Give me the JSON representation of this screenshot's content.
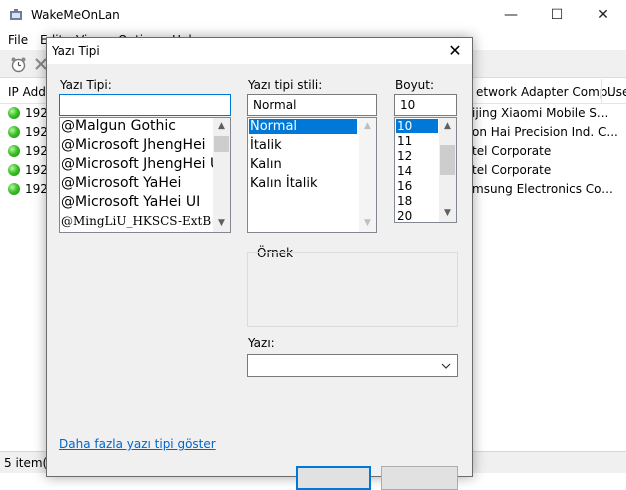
{
  "window": {
    "title": "WakeMeOnLan",
    "menu": [
      "File",
      "Edit",
      "View",
      "Options",
      "Help"
    ]
  },
  "list": {
    "columns": [
      "IP Addr",
      "etwork Adapter Comp...",
      "Use"
    ],
    "rows": [
      {
        "ip": "192.",
        "adapter": "ijing Xiaomi Mobile S..."
      },
      {
        "ip": "192.",
        "adapter": "on Hai Precision Ind. C..."
      },
      {
        "ip": "192.",
        "adapter": "tel Corporate"
      },
      {
        "ip": "192.",
        "adapter": "tel Corporate"
      },
      {
        "ip": "192.",
        "adapter": "msung Electronics Co..."
      }
    ]
  },
  "status": {
    "text": "5 item(s)"
  },
  "dialog": {
    "title": "Yazı Tipi",
    "font": {
      "label": "Yazı Tipi:",
      "value": "",
      "items": [
        "@Malgun Gothic",
        "@Microsoft JhengHei",
        "@Microsoft JhengHei U",
        "@Microsoft YaHei",
        "@Microsoft YaHei UI",
        "@MingLiU_HKSCS-ExtB"
      ]
    },
    "style": {
      "label": "Yazı tipi stili:",
      "value": "Normal",
      "items": [
        "Normal",
        "İtalik",
        "Kalın",
        "Kalın İtalik"
      ]
    },
    "size": {
      "label": "Boyut:",
      "value": "10",
      "items": [
        "10",
        "11",
        "12",
        "14",
        "16",
        "18",
        "20"
      ]
    },
    "sample": {
      "label": "Örnek"
    },
    "script": {
      "label": "Yazı:",
      "value": ""
    },
    "more_fonts_link": "Daha fazla yazı tipi göster"
  }
}
